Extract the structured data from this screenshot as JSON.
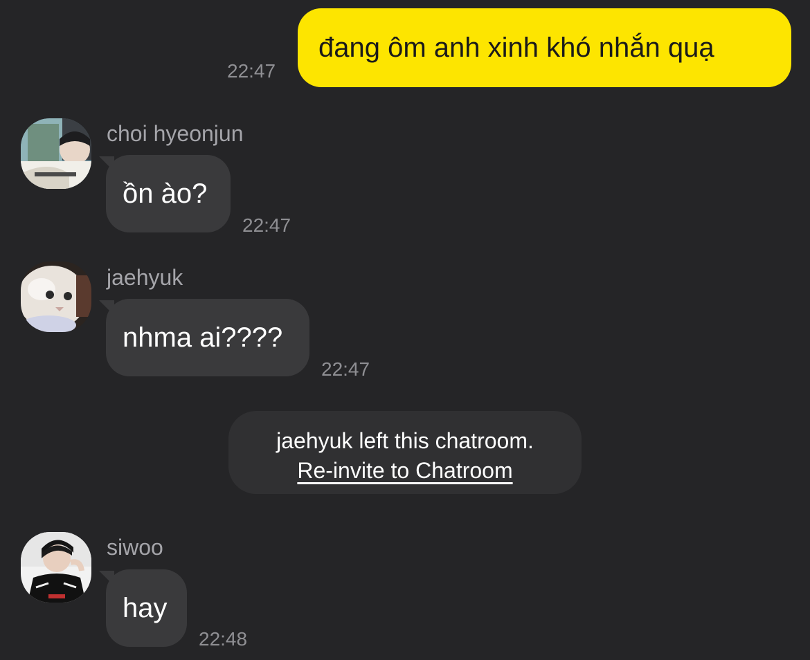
{
  "messages": [
    {
      "side": "out",
      "text": "đang ôm anh xinh khó nhắn quạ",
      "time": "22:47"
    },
    {
      "side": "in",
      "sender": "choi hyeonjun",
      "text": "ồn ào?",
      "time": "22:47"
    },
    {
      "side": "in",
      "sender": "jaehyuk",
      "text": "nhma ai????",
      "time": "22:47"
    },
    {
      "side": "in",
      "sender": "siwoo",
      "text": "hay",
      "time": "22:48"
    }
  ],
  "system_notice": {
    "text": "jaehyuk left this chatroom.",
    "action": "Re-invite to Chatroom"
  },
  "colors": {
    "background": "#252527",
    "outgoing_bubble": "#fde500",
    "incoming_bubble": "#3a3a3c"
  }
}
